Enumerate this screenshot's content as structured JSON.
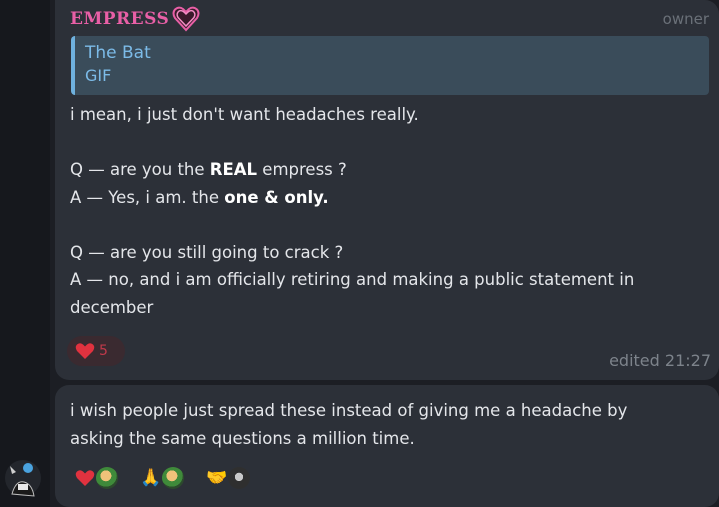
{
  "message1": {
    "sender": "EMPRESS",
    "sender_role": "owner",
    "reply": {
      "title": "The Bat",
      "type": "GIF"
    },
    "lines": [
      {
        "segments": [
          {
            "text": "i mean, i just don't want headaches really.",
            "bold": false
          }
        ]
      },
      {
        "segments": [
          {
            "text": "",
            "bold": false
          }
        ]
      },
      {
        "segments": [
          {
            "text": "Q — are you the ",
            "bold": false
          },
          {
            "text": "REAL",
            "bold": true
          },
          {
            "text": " empress ?",
            "bold": false
          }
        ]
      },
      {
        "segments": [
          {
            "text": "A — Yes, i am. the ",
            "bold": false
          },
          {
            "text": "one & only.",
            "bold": true
          }
        ]
      },
      {
        "segments": [
          {
            "text": "",
            "bold": false
          }
        ]
      },
      {
        "segments": [
          {
            "text": "Q — are you still going to crack ?",
            "bold": false
          }
        ]
      },
      {
        "segments": [
          {
            "text": "A — no, and i am officially retiring and making a public statement in",
            "bold": false
          }
        ]
      },
      {
        "segments": [
          {
            "text": "december",
            "bold": false
          }
        ]
      }
    ],
    "reaction": {
      "emoji": "♥",
      "count": "5"
    },
    "edited": "edited 21:27"
  },
  "message2": {
    "lines": [
      "i wish people just spread these instead of giving me a headache by",
      "asking the same questions a million time."
    ],
    "reactions": [
      {
        "emoji": "❤",
        "avatar": "green"
      },
      {
        "emoji": "🙏",
        "avatar": "green"
      },
      {
        "emoji": "🤝",
        "avatar": "dark"
      }
    ]
  },
  "colors": {
    "sender": "#e85fa6",
    "reply_accent": "#6fb1de",
    "bubble": "#2c3038",
    "heart": "#e0323f"
  }
}
